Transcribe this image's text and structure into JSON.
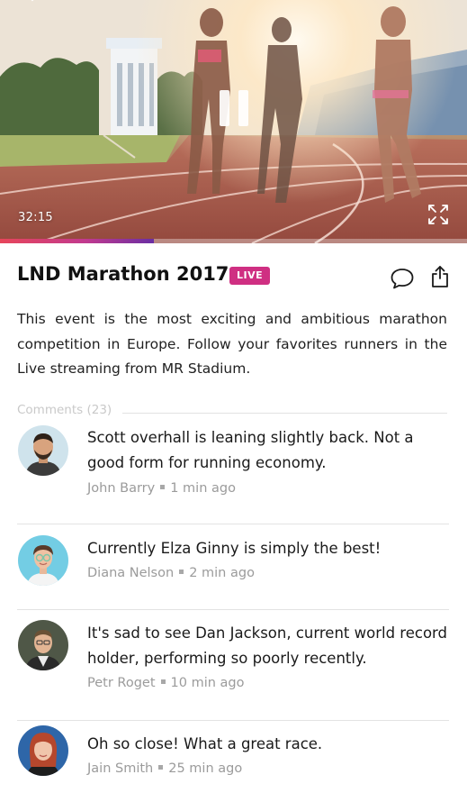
{
  "video": {
    "timecode": "32:15",
    "progress": 0.33,
    "accent_start": "#e7455a",
    "accent_end": "#6a2ea3",
    "icons": [
      "chevron-down-icon",
      "pause-icon",
      "fullscreen-icon"
    ]
  },
  "event": {
    "title": "LND Marathon 2017",
    "live_label": "LIVE",
    "live_color": "#cf2f82",
    "description": "This event is the most exciting and ambitious marathon competition in Europe. Follow your favorites runners in the Live streaming from MR Stadium.",
    "icons": [
      "comment-icon",
      "share-icon"
    ]
  },
  "comments": {
    "header": "Comments (23)",
    "items": [
      {
        "text": "Scott overhall is leaning slightly back. Not a good form for running economy.",
        "author": "John Barry",
        "time": "1 min ago"
      },
      {
        "text": "Currently Elza Ginny is simply the best!",
        "author": "Diana Nelson",
        "time": "2 min ago"
      },
      {
        "text": "It's sad to see Dan Jackson, current world record holder, performing so poorly recently.",
        "author": "Petr Roget",
        "time": "10 min ago"
      },
      {
        "text": "Oh so close! What a great race.",
        "author": "Jain Smith",
        "time": "25 min ago"
      }
    ]
  }
}
